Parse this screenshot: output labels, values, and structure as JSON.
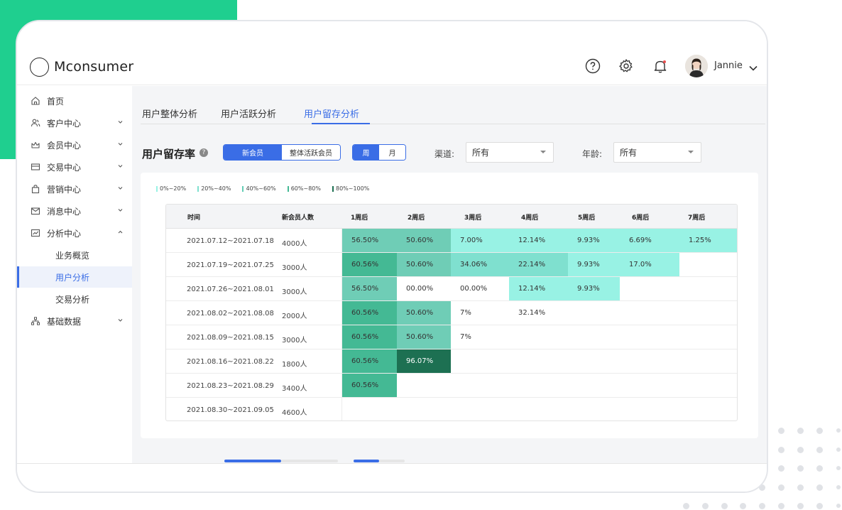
{
  "app": {
    "name": "Mconsumer"
  },
  "user": {
    "name": "Jannie"
  },
  "sidebar": {
    "items": [
      {
        "label": "首页",
        "icon": "home-icon",
        "chevron": false
      },
      {
        "label": "客户中心",
        "icon": "customers-icon",
        "chevron": true
      },
      {
        "label": "会员中心",
        "icon": "crown-icon",
        "chevron": true
      },
      {
        "label": "交易中心",
        "icon": "card-icon",
        "chevron": true
      },
      {
        "label": "营销中心",
        "icon": "bag-icon",
        "chevron": true
      },
      {
        "label": "消息中心",
        "icon": "mail-icon",
        "chevron": true
      },
      {
        "label": "分析中心",
        "icon": "chart-icon",
        "chevron": true,
        "expanded": true
      },
      {
        "label": "基础数据",
        "icon": "structure-icon",
        "chevron": true
      }
    ],
    "sub_items": [
      {
        "label": "业务概览"
      },
      {
        "label": "用户分析",
        "active": true
      },
      {
        "label": "交易分析"
      }
    ]
  },
  "tabs": [
    {
      "label": "用户整体分析"
    },
    {
      "label": "用户活跃分析"
    },
    {
      "label": "用户留存分析",
      "active": true
    }
  ],
  "section": {
    "title": "用户留存率",
    "help": "?"
  },
  "member_toggle": {
    "options": [
      "新会员",
      "整体活跃会员"
    ],
    "selected": 0
  },
  "period_toggle": {
    "options": [
      "周",
      "月"
    ],
    "selected": 0
  },
  "filters": {
    "channel": {
      "label": "渠道:",
      "value": "所有"
    },
    "age": {
      "label": "年龄:",
      "value": "所有"
    }
  },
  "legend": [
    {
      "label": "0%~20%",
      "color": "#98f2e4"
    },
    {
      "label": "20%~40%",
      "color": "#7fe0cf"
    },
    {
      "label": "40%~60%",
      "color": "#63cdb5"
    },
    {
      "label": "60%~80%",
      "color": "#44b994"
    },
    {
      "label": "80%~100%",
      "color": "#1d7052"
    }
  ],
  "table": {
    "headers": [
      "时间",
      "新会员人数",
      "1周后",
      "2周后",
      "3周后",
      "4周后",
      "5周后",
      "6周后",
      "7周后"
    ],
    "rows": [
      {
        "period": "2021.07.12~2021.07.18",
        "count": "4000人",
        "values": [
          "56.50%",
          "50.60%",
          "7.00%",
          "12.14%",
          "9.93%",
          "6.69%",
          "1.25%"
        ]
      },
      {
        "period": "2021.07.19~2021.07.25",
        "count": "3000人",
        "values": [
          "60.56%",
          "50.60%",
          "34.06%",
          "22.14%",
          "9.93%",
          "17.0%"
        ]
      },
      {
        "period": "2021.07.26~2021.08.01",
        "count": "3000人",
        "values": [
          "56.50%",
          "00.00%",
          "00.00%",
          "12.14%",
          "9.93%"
        ]
      },
      {
        "period": "2021.08.02~2021.08.08",
        "count": "2000人",
        "values": [
          "60.56%",
          "50.60%",
          "7%",
          "32.14%"
        ]
      },
      {
        "period": "2021.08.09~2021.08.15",
        "count": "3000人",
        "values": [
          "60.56%",
          "50.60%",
          "7%"
        ]
      },
      {
        "period": "2021.08.16~2021.08.22",
        "count": "1800人",
        "values": [
          "60.56%",
          "96.07%"
        ]
      },
      {
        "period": "2021.08.23~2021.08.29",
        "count": "3400人",
        "values": [
          "60.56%"
        ]
      },
      {
        "period": "2021.08.30~2021.09.05",
        "count": "4600人",
        "values": []
      }
    ],
    "cell_colors": [
      [
        "#6fcdb6",
        "#6fcdb6",
        "#98f2e4",
        "#98f2e4",
        "#98f2e4",
        "#98f2e4",
        "#98f2e4"
      ],
      [
        "#44b994",
        "#6fcdb6",
        "#7fe0cf",
        "#7fe0cf",
        "#98f2e4",
        "#98f2e4"
      ],
      [
        "#6fcdb6",
        "none",
        "none",
        "#98f2e4",
        "#98f2e4"
      ],
      [
        "#44b994",
        "#6fcdb6",
        "none",
        "none"
      ],
      [
        "#44b994",
        "#6fcdb6",
        "none"
      ],
      [
        "#44b994",
        "#1d7052"
      ],
      [
        "#44b994"
      ],
      []
    ]
  },
  "colors": {
    "accent": "#3a6de6",
    "brand_green": "#1fcf8f"
  }
}
